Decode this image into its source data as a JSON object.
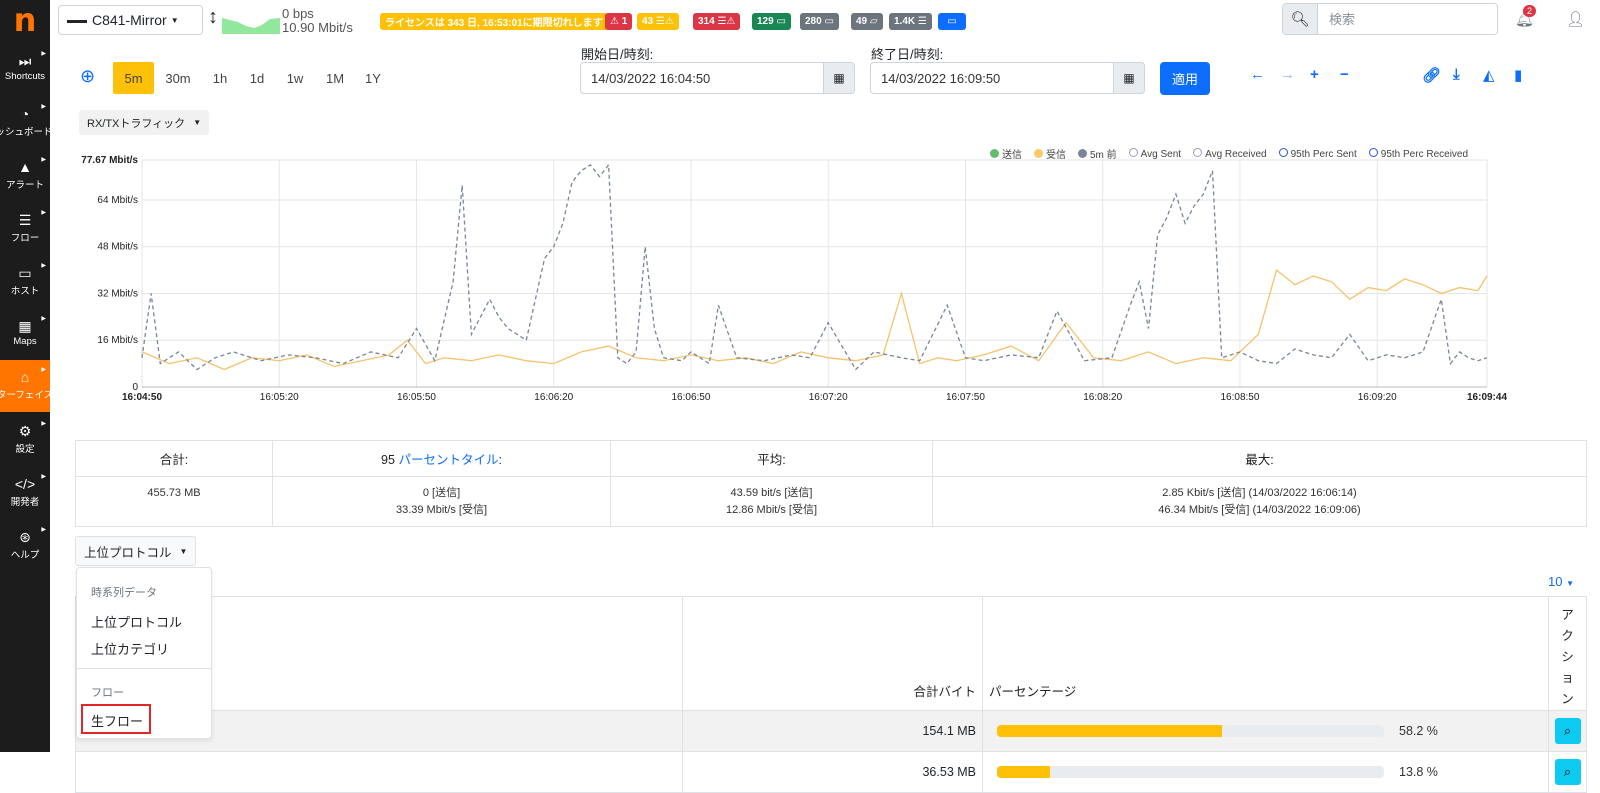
{
  "sidebar": {
    "logo": "n",
    "items": [
      {
        "icon": "fast-forward-icon",
        "label": "Shortcuts"
      },
      {
        "icon": "dashboard-icon",
        "label": "ダッシュボード"
      },
      {
        "icon": "alert-icon",
        "label": "アラート"
      },
      {
        "icon": "flows-icon",
        "label": "フロー"
      },
      {
        "icon": "laptop-icon",
        "label": "ホスト"
      },
      {
        "icon": "map-icon",
        "label": "Maps"
      },
      {
        "icon": "interface-icon",
        "label": "インターフェイス"
      },
      {
        "icon": "gear-icon",
        "label": "設定"
      },
      {
        "icon": "code-icon",
        "label": "開発者"
      },
      {
        "icon": "help-icon",
        "label": "ヘルプ"
      }
    ]
  },
  "header": {
    "interface": "C841-Mirror",
    "rate_tx": "0 bps",
    "rate_rx": "10.90 Mbit/s",
    "license": "ライセンスは 343 日, 16:53:01に期限切れします",
    "badges": {
      "alerts": "1",
      "flow_warn": "43",
      "flow_err": "314",
      "hosts_green": "129",
      "hosts_grey": "280",
      "devices": "49",
      "flows_total": "1.4K"
    },
    "search_placeholder": "検索",
    "notifications": "2"
  },
  "toolbar": {
    "ranges": [
      "5m",
      "30m",
      "1h",
      "1d",
      "1w",
      "1M",
      "1Y"
    ],
    "active_range": "5m",
    "start_label": "開始日/時刻:",
    "start_value": "14/03/2022 16:04:50",
    "end_label": "終了日/時刻:",
    "end_value": "14/03/2022 16:09:50",
    "apply": "適用",
    "metric_select": "RX/TXトラフィック"
  },
  "legend": [
    {
      "label": "送信",
      "color": "#66bb6a",
      "style": "filled"
    },
    {
      "label": "受信",
      "color": "#ffc864",
      "style": "filled"
    },
    {
      "label": "5m 前",
      "color": "#78869a",
      "style": "filled"
    },
    {
      "label": "Avg Sent",
      "color": "#9a9ac8",
      "style": "ring"
    },
    {
      "label": "Avg Received",
      "color": "#9a9ac8",
      "style": "ring"
    },
    {
      "label": "95th Perc Sent",
      "color": "#2f4fe0",
      "style": "ring"
    },
    {
      "label": "95th Perc Received",
      "color": "#2f4fe0",
      "style": "ring"
    }
  ],
  "chart_data": {
    "type": "line",
    "y_ticks": [
      "0",
      "16 Mbit/s",
      "32 Mbit/s",
      "48 Mbit/s",
      "64 Mbit/s",
      "77.67 Mbit/s"
    ],
    "y_tick_values": [
      0,
      16,
      32,
      48,
      64,
      77.67
    ],
    "ylim": [
      0,
      77.67
    ],
    "x_ticks": [
      "16:04:50",
      "16:05:20",
      "16:05:50",
      "16:06:20",
      "16:06:50",
      "16:07:20",
      "16:07:50",
      "16:08:20",
      "16:08:50",
      "16:09:20",
      "16:09:44"
    ],
    "x_tick_seconds": [
      0,
      30,
      60,
      90,
      120,
      150,
      180,
      210,
      240,
      270,
      294
    ],
    "xlim": [
      0,
      294
    ],
    "grid": true,
    "series": [
      {
        "name": "受信",
        "color": "#f7c26b",
        "dashed": false,
        "x": [
          0,
          6,
          12,
          18,
          24,
          30,
          36,
          42,
          48,
          54,
          58,
          62,
          66,
          72,
          78,
          84,
          90,
          96,
          102,
          108,
          114,
          120,
          126,
          132,
          138,
          144,
          150,
          156,
          162,
          166,
          170,
          174,
          178,
          184,
          190,
          196,
          202,
          208,
          214,
          220,
          226,
          232,
          238,
          244,
          248,
          252,
          256,
          260,
          264,
          268,
          272,
          276,
          280,
          284,
          288,
          292,
          294
        ],
        "values": [
          12,
          8,
          10,
          6,
          10,
          9,
          11,
          7,
          9,
          11,
          16,
          8,
          10,
          9,
          11,
          9,
          8,
          12,
          14,
          10,
          9,
          11,
          9,
          10,
          8,
          12,
          10,
          9,
          11,
          32,
          8,
          10,
          9,
          11,
          14,
          9,
          22,
          10,
          9,
          12,
          8,
          10,
          9,
          18,
          40,
          35,
          38,
          36,
          30,
          34,
          33,
          37,
          35,
          32,
          34,
          33,
          38
        ]
      },
      {
        "name": "5m 前",
        "color": "#78869a",
        "dashed": true,
        "x": [
          0,
          2,
          4,
          8,
          12,
          16,
          20,
          26,
          32,
          38,
          44,
          50,
          56,
          60,
          64,
          68,
          70,
          72,
          76,
          78,
          80,
          84,
          86,
          88,
          90,
          92,
          94,
          96,
          98,
          100,
          102,
          104,
          106,
          108,
          110,
          112,
          114,
          118,
          120,
          124,
          126,
          130,
          136,
          142,
          146,
          150,
          156,
          160,
          166,
          170,
          176,
          180,
          184,
          190,
          196,
          200,
          206,
          212,
          216,
          218,
          220,
          222,
          224,
          226,
          228,
          230,
          232,
          234,
          236,
          240,
          244,
          248,
          252,
          256,
          260,
          264,
          268,
          272,
          276,
          280,
          284,
          286,
          288,
          290,
          292,
          294
        ],
        "values": [
          10,
          32,
          8,
          12,
          6,
          10,
          12,
          9,
          11,
          10,
          8,
          12,
          10,
          20,
          9,
          36,
          69,
          18,
          30,
          24,
          20,
          16,
          30,
          44,
          48,
          56,
          70,
          74,
          76,
          72,
          76,
          10,
          8,
          12,
          48,
          20,
          10,
          9,
          12,
          8,
          28,
          10,
          9,
          11,
          10,
          22,
          6,
          12,
          10,
          9,
          28,
          10,
          9,
          11,
          10,
          26,
          9,
          10,
          28,
          36,
          20,
          52,
          58,
          66,
          56,
          62,
          66,
          74,
          10,
          12,
          9,
          8,
          13,
          11,
          10,
          18,
          9,
          11,
          10,
          12,
          30,
          8,
          12,
          10,
          9,
          10
        ]
      }
    ]
  },
  "stats": {
    "headers": [
      "合計:",
      "95",
      "パーセントタイル",
      ":",
      "平均:",
      "最大:"
    ],
    "total": "455.73 MB",
    "p95_sent": "0 [送信]",
    "p95_rcvd": "33.39 Mbit/s [受信]",
    "avg_sent": "43.59 bit/s [送信]",
    "avg_rcvd": "12.86 Mbit/s [受信]",
    "max_sent": "2.85 Kbit/s [送信] (14/03/2022 16:06:14)",
    "max_rcvd": "46.34 Mbit/s [受信] (14/03/2022 16:09:06)"
  },
  "protocols": {
    "button": "上位プロトコル",
    "page_size": "10",
    "col_bytes": "合計バイト",
    "col_pct": "パーセンテージ",
    "col_action": "アクション",
    "rows": [
      {
        "bytes": "154.1 MB",
        "pct_text": "58.2 %",
        "pct": 58.2
      },
      {
        "bytes": "36.53 MB",
        "pct_text": "13.8 %",
        "pct": 13.8
      }
    ]
  },
  "menu": {
    "header1": "時系列データ",
    "item1": "上位プロトコル",
    "item2": "上位カテゴリ",
    "header2": "フロー",
    "item3": "生フロー"
  }
}
